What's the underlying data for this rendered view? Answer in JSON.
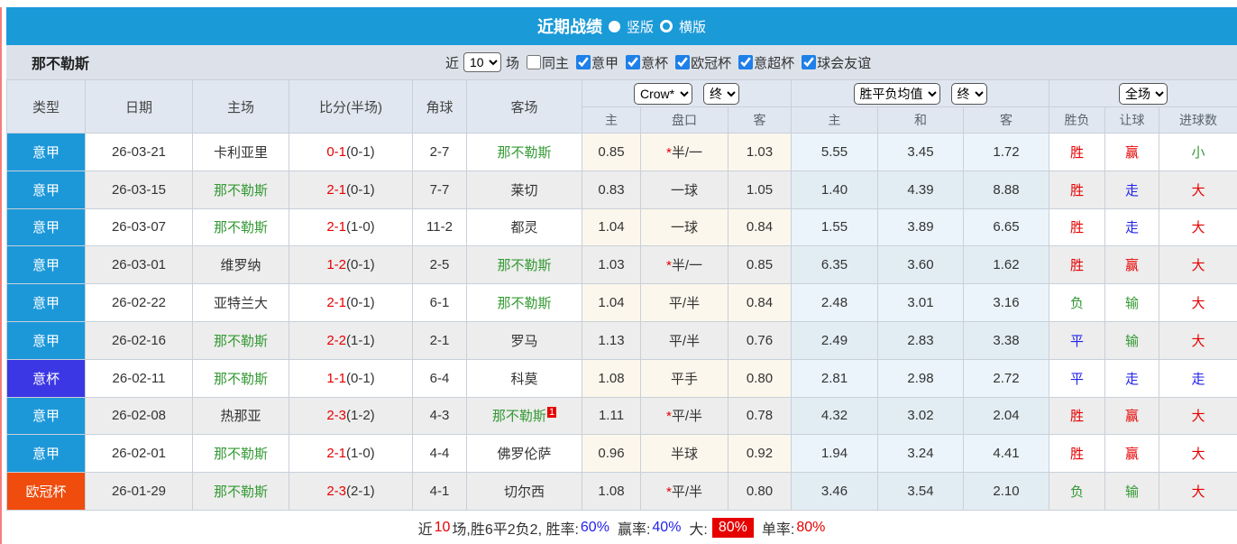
{
  "colors": {
    "topbar_blue": "#1b9ad8",
    "red": "#e60000",
    "green": "#339933",
    "blue": "#2222ee",
    "big_rate_bg": "#e60000"
  },
  "topbar": {
    "title": "近期战绩",
    "vertical_label": "竖版",
    "horizontal_label": "横版"
  },
  "filter": {
    "team": "那不勒斯",
    "recent_label": "近",
    "recent_value": "10",
    "matches_label": "场",
    "same_home_label": "同主",
    "same_home_checked": false,
    "leagues": [
      "意甲",
      "意杯",
      "欧冠杯",
      "意超杯",
      "球会友谊"
    ],
    "leagues_checked": [
      true,
      true,
      true,
      true,
      true
    ]
  },
  "table": {
    "headers": {
      "type": "类型",
      "date": "日期",
      "home": "主场",
      "score": "比分(半场)",
      "corners": "角球",
      "away": "客场"
    },
    "selects": {
      "odds_source": "Crow*",
      "odds_time": "终",
      "avg_source": "胜平负均值",
      "avg_time": "终",
      "scope": "全场"
    },
    "subheaders": {
      "odds_home": "主",
      "handicap": "盘口",
      "odds_away": "客",
      "avg_win": "主",
      "avg_draw": "和",
      "avg_lose": "客",
      "result": "胜负",
      "handicap_result": "让球",
      "goals": "进球数"
    },
    "league_colors": {
      "意甲": "#1c98d9",
      "意杯": "#3c37e5",
      "欧冠杯": "#ef4c0d"
    },
    "rows": [
      {
        "league": "意甲",
        "date": "26-03-21",
        "home": "卡利亚里",
        "home_is_team": false,
        "score": "0-1",
        "half": "(0-1)",
        "corners": "2-7",
        "away": "那不勒斯",
        "away_is_team": true,
        "away_sup": "",
        "odds_home": "0.85",
        "handicap": "半/一",
        "handicap_star": true,
        "odds_away": "1.03",
        "avg_win": "5.55",
        "avg_draw": "3.45",
        "avg_lose": "1.72",
        "result": {
          "text": "胜",
          "cls": "red"
        },
        "handicap_res": {
          "text": "赢",
          "cls": "red"
        },
        "goals": {
          "text": "小",
          "cls": "green"
        }
      },
      {
        "league": "意甲",
        "date": "26-03-15",
        "home": "那不勒斯",
        "home_is_team": true,
        "score": "2-1",
        "half": "(0-1)",
        "corners": "7-7",
        "away": "莱切",
        "away_is_team": false,
        "away_sup": "",
        "odds_home": "0.83",
        "handicap": "一球",
        "handicap_star": false,
        "odds_away": "1.05",
        "avg_win": "1.40",
        "avg_draw": "4.39",
        "avg_lose": "8.88",
        "result": {
          "text": "胜",
          "cls": "red"
        },
        "handicap_res": {
          "text": "走",
          "cls": "blue"
        },
        "goals": {
          "text": "大",
          "cls": "red"
        }
      },
      {
        "league": "意甲",
        "date": "26-03-07",
        "home": "那不勒斯",
        "home_is_team": true,
        "score": "2-1",
        "half": "(1-0)",
        "corners": "11-2",
        "away": "都灵",
        "away_is_team": false,
        "away_sup": "",
        "odds_home": "1.04",
        "handicap": "一球",
        "handicap_star": false,
        "odds_away": "0.84",
        "avg_win": "1.55",
        "avg_draw": "3.89",
        "avg_lose": "6.65",
        "result": {
          "text": "胜",
          "cls": "red"
        },
        "handicap_res": {
          "text": "走",
          "cls": "blue"
        },
        "goals": {
          "text": "大",
          "cls": "red"
        }
      },
      {
        "league": "意甲",
        "date": "26-03-01",
        "home": "维罗纳",
        "home_is_team": false,
        "score": "1-2",
        "half": "(0-1)",
        "corners": "2-5",
        "away": "那不勒斯",
        "away_is_team": true,
        "away_sup": "",
        "odds_home": "1.03",
        "handicap": "半/一",
        "handicap_star": true,
        "odds_away": "0.85",
        "avg_win": "6.35",
        "avg_draw": "3.60",
        "avg_lose": "1.62",
        "result": {
          "text": "胜",
          "cls": "red"
        },
        "handicap_res": {
          "text": "赢",
          "cls": "red"
        },
        "goals": {
          "text": "大",
          "cls": "red"
        }
      },
      {
        "league": "意甲",
        "date": "26-02-22",
        "home": "亚特兰大",
        "home_is_team": false,
        "score": "2-1",
        "half": "(0-1)",
        "corners": "6-1",
        "away": "那不勒斯",
        "away_is_team": true,
        "away_sup": "",
        "odds_home": "1.04",
        "handicap": "平/半",
        "handicap_star": false,
        "odds_away": "0.84",
        "avg_win": "2.48",
        "avg_draw": "3.01",
        "avg_lose": "3.16",
        "result": {
          "text": "负",
          "cls": "green"
        },
        "handicap_res": {
          "text": "输",
          "cls": "green"
        },
        "goals": {
          "text": "大",
          "cls": "red"
        }
      },
      {
        "league": "意甲",
        "date": "26-02-16",
        "home": "那不勒斯",
        "home_is_team": true,
        "score": "2-2",
        "half": "(1-1)",
        "corners": "2-1",
        "away": "罗马",
        "away_is_team": false,
        "away_sup": "",
        "odds_home": "1.13",
        "handicap": "平/半",
        "handicap_star": false,
        "odds_away": "0.76",
        "avg_win": "2.49",
        "avg_draw": "2.83",
        "avg_lose": "3.38",
        "result": {
          "text": "平",
          "cls": "blue"
        },
        "handicap_res": {
          "text": "输",
          "cls": "green"
        },
        "goals": {
          "text": "大",
          "cls": "red"
        }
      },
      {
        "league": "意杯",
        "date": "26-02-11",
        "home": "那不勒斯",
        "home_is_team": true,
        "score": "1-1",
        "half": "(0-1)",
        "corners": "6-4",
        "away": "科莫",
        "away_is_team": false,
        "away_sup": "",
        "odds_home": "1.08",
        "handicap": "平手",
        "handicap_star": false,
        "odds_away": "0.80",
        "avg_win": "2.81",
        "avg_draw": "2.98",
        "avg_lose": "2.72",
        "result": {
          "text": "平",
          "cls": "blue"
        },
        "handicap_res": {
          "text": "走",
          "cls": "blue"
        },
        "goals": {
          "text": "走",
          "cls": "blue"
        }
      },
      {
        "league": "意甲",
        "date": "26-02-08",
        "home": "热那亚",
        "home_is_team": false,
        "score": "2-3",
        "half": "(1-2)",
        "corners": "4-3",
        "away": "那不勒斯",
        "away_is_team": true,
        "away_sup": "1",
        "odds_home": "1.11",
        "handicap": "平/半",
        "handicap_star": true,
        "odds_away": "0.78",
        "avg_win": "4.32",
        "avg_draw": "3.02",
        "avg_lose": "2.04",
        "result": {
          "text": "胜",
          "cls": "red"
        },
        "handicap_res": {
          "text": "赢",
          "cls": "red"
        },
        "goals": {
          "text": "大",
          "cls": "red"
        }
      },
      {
        "league": "意甲",
        "date": "26-02-01",
        "home": "那不勒斯",
        "home_is_team": true,
        "score": "2-1",
        "half": "(1-0)",
        "corners": "4-4",
        "away": "佛罗伦萨",
        "away_is_team": false,
        "away_sup": "",
        "odds_home": "0.96",
        "handicap": "半球",
        "handicap_star": false,
        "odds_away": "0.92",
        "avg_win": "1.94",
        "avg_draw": "3.24",
        "avg_lose": "4.41",
        "result": {
          "text": "胜",
          "cls": "red"
        },
        "handicap_res": {
          "text": "赢",
          "cls": "red"
        },
        "goals": {
          "text": "大",
          "cls": "red"
        }
      },
      {
        "league": "欧冠杯",
        "date": "26-01-29",
        "home": "那不勒斯",
        "home_is_team": true,
        "score": "2-3",
        "half": "(2-1)",
        "corners": "4-1",
        "away": "切尔西",
        "away_is_team": false,
        "away_sup": "",
        "odds_home": "1.08",
        "handicap": "平/半",
        "handicap_star": true,
        "odds_away": "0.80",
        "avg_win": "3.46",
        "avg_draw": "3.54",
        "avg_lose": "2.10",
        "result": {
          "text": "负",
          "cls": "green"
        },
        "handicap_res": {
          "text": "输",
          "cls": "green"
        },
        "goals": {
          "text": "大",
          "cls": "red"
        }
      }
    ]
  },
  "summary": {
    "t1": "近",
    "t2": "10",
    "t3": "场,胜6平2负2, 胜率:",
    "t4": "60%",
    "t5": "赢率:",
    "t6": "40%",
    "t7": "大:",
    "t8": "80%",
    "t9": "单率:",
    "t10": "80%"
  }
}
